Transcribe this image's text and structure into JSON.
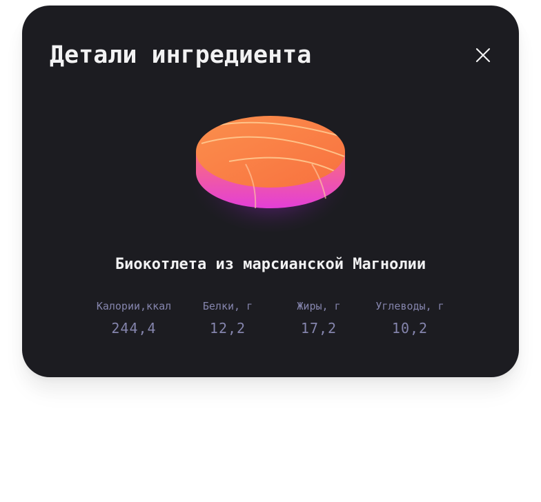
{
  "modal": {
    "title": "Детали ингредиента",
    "close_icon": "close-icon"
  },
  "ingredient": {
    "image_icon": "meat-patty-illustration",
    "name": "Биокотлета из марсианской Магнолии",
    "nutrients": [
      {
        "label": "Калории,ккал",
        "value": "244,4"
      },
      {
        "label": "Белки, г",
        "value": "12,2"
      },
      {
        "label": "Жиры, г",
        "value": "17,2"
      },
      {
        "label": "Углеводы, г",
        "value": "10,2"
      }
    ]
  },
  "colors": {
    "modal_bg": "#1c1c21",
    "text_primary": "#f2f2f3",
    "text_inactive": "#8585ad",
    "patty_top": "#f98a4a",
    "patty_side": "#e740d8"
  }
}
